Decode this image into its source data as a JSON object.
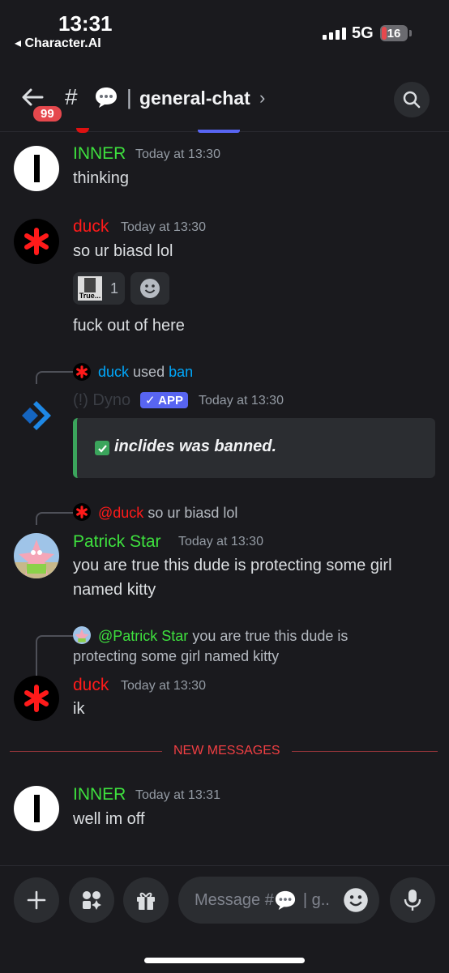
{
  "status": {
    "time": "13:31",
    "back_app": "◂ Character.AI",
    "network": "5G",
    "battery": "16"
  },
  "header": {
    "badge": "99",
    "hash": "#",
    "pipe": "|",
    "channel": "general-chat",
    "chevron": "›"
  },
  "messages": {
    "m1": {
      "author": "INNER",
      "time": "Today at 13:30",
      "text": "thinking"
    },
    "m2": {
      "author": "duck",
      "time": "Today at 13:30",
      "text": "so ur biasd lol",
      "reaction_label": "True...",
      "reaction_count": "1",
      "text2": "fuck out of here"
    },
    "m3": {
      "cmd_user": "duck",
      "cmd_used": "used",
      "cmd_name": "ban",
      "author": "(!) Dyno",
      "app_tag": "✓ APP",
      "time": "Today at 13:30",
      "embed_text": "inclides was banned."
    },
    "m4": {
      "reply_user": "@duck",
      "reply_text": "so ur biasd lol",
      "author": "Patrick Star",
      "time": "Today at 13:30",
      "text1": "you are true this dude is protecting some girl",
      "text2": "named kitty"
    },
    "m5": {
      "reply_user": "@Patrick Star",
      "reply_text1": "you are true this dude is",
      "reply_text2": "protecting some girl named kitty",
      "author": "duck",
      "time": "Today at 13:30",
      "text": "ik"
    },
    "new_messages": "NEW MESSAGES",
    "m6": {
      "author": "INNER",
      "time": "Today at 13:31",
      "text": "well im off"
    }
  },
  "composer": {
    "placeholder": "Message #",
    "placeholder_tail": "| g.."
  },
  "colors": {
    "green_name": "#3ee03e",
    "red_name": "#ff1a1a",
    "accent": "#5865f2",
    "new_msg": "#f23f43"
  }
}
